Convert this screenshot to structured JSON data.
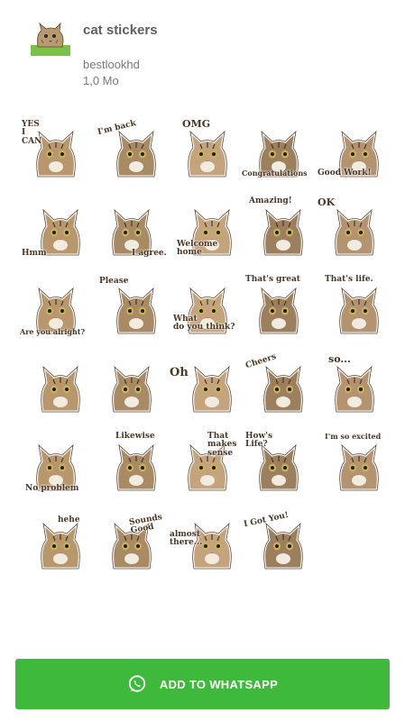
{
  "pack": {
    "title": "cat stickers",
    "author": "bestlookhd",
    "size": "1,0 Mo",
    "icon": "cat-sticker-icon",
    "icon_caption": "I'm back"
  },
  "stickers": [
    {
      "caption": "YES\nI\nCAN",
      "icon": "cat-yes-i-can"
    },
    {
      "caption": "I'm back",
      "icon": "cat-im-back"
    },
    {
      "caption": "OMG",
      "icon": "cat-omg"
    },
    {
      "caption": "Congratulations",
      "icon": "cat-congratulations"
    },
    {
      "caption": "Good Work!",
      "icon": "cat-good-work"
    },
    {
      "caption": "Hmm",
      "icon": "cat-hmm"
    },
    {
      "caption": "I agree.",
      "icon": "cat-i-agree"
    },
    {
      "caption": "Welcome\nhome",
      "icon": "cat-welcome-home"
    },
    {
      "caption": "Amazing!",
      "icon": "cat-amazing"
    },
    {
      "caption": "OK",
      "icon": "cat-ok-sign"
    },
    {
      "caption": "Are you alright?",
      "icon": "cat-are-you-alright"
    },
    {
      "caption": "Please",
      "icon": "cat-please"
    },
    {
      "caption": "What\ndo you think?",
      "icon": "cat-what-do-you-think"
    },
    {
      "caption": "That's great",
      "icon": "cat-thats-great"
    },
    {
      "caption": "That's life.",
      "icon": "cat-thats-life"
    },
    {
      "caption": "",
      "icon": "cat-surprised"
    },
    {
      "caption": "",
      "icon": "cat-fire-breath"
    },
    {
      "caption": "Oh",
      "icon": "cat-oh"
    },
    {
      "caption": "Cheers",
      "icon": "cat-cheers"
    },
    {
      "caption": "so...",
      "icon": "cat-so"
    },
    {
      "caption": "No problem",
      "icon": "cat-no-problem"
    },
    {
      "caption": "Likewise",
      "icon": "cat-likewise"
    },
    {
      "caption": "That\nmakes\nsense",
      "icon": "cat-that-makes-sense"
    },
    {
      "caption": "How's\nLife?",
      "icon": "cat-hows-life"
    },
    {
      "caption": "I'm so excited",
      "icon": "cat-im-so-excited"
    },
    {
      "caption": "hehe",
      "icon": "cat-hehe"
    },
    {
      "caption": "Sounds\nGood",
      "icon": "cat-sounds-good"
    },
    {
      "caption": "almost\nthere...",
      "icon": "cat-almost-there"
    },
    {
      "caption": "I Got You!",
      "icon": "cat-i-got-you"
    }
  ],
  "button": {
    "label": "ADD TO WHATSAPP",
    "icon": "whatsapp-icon",
    "color": "#3fb93b"
  }
}
